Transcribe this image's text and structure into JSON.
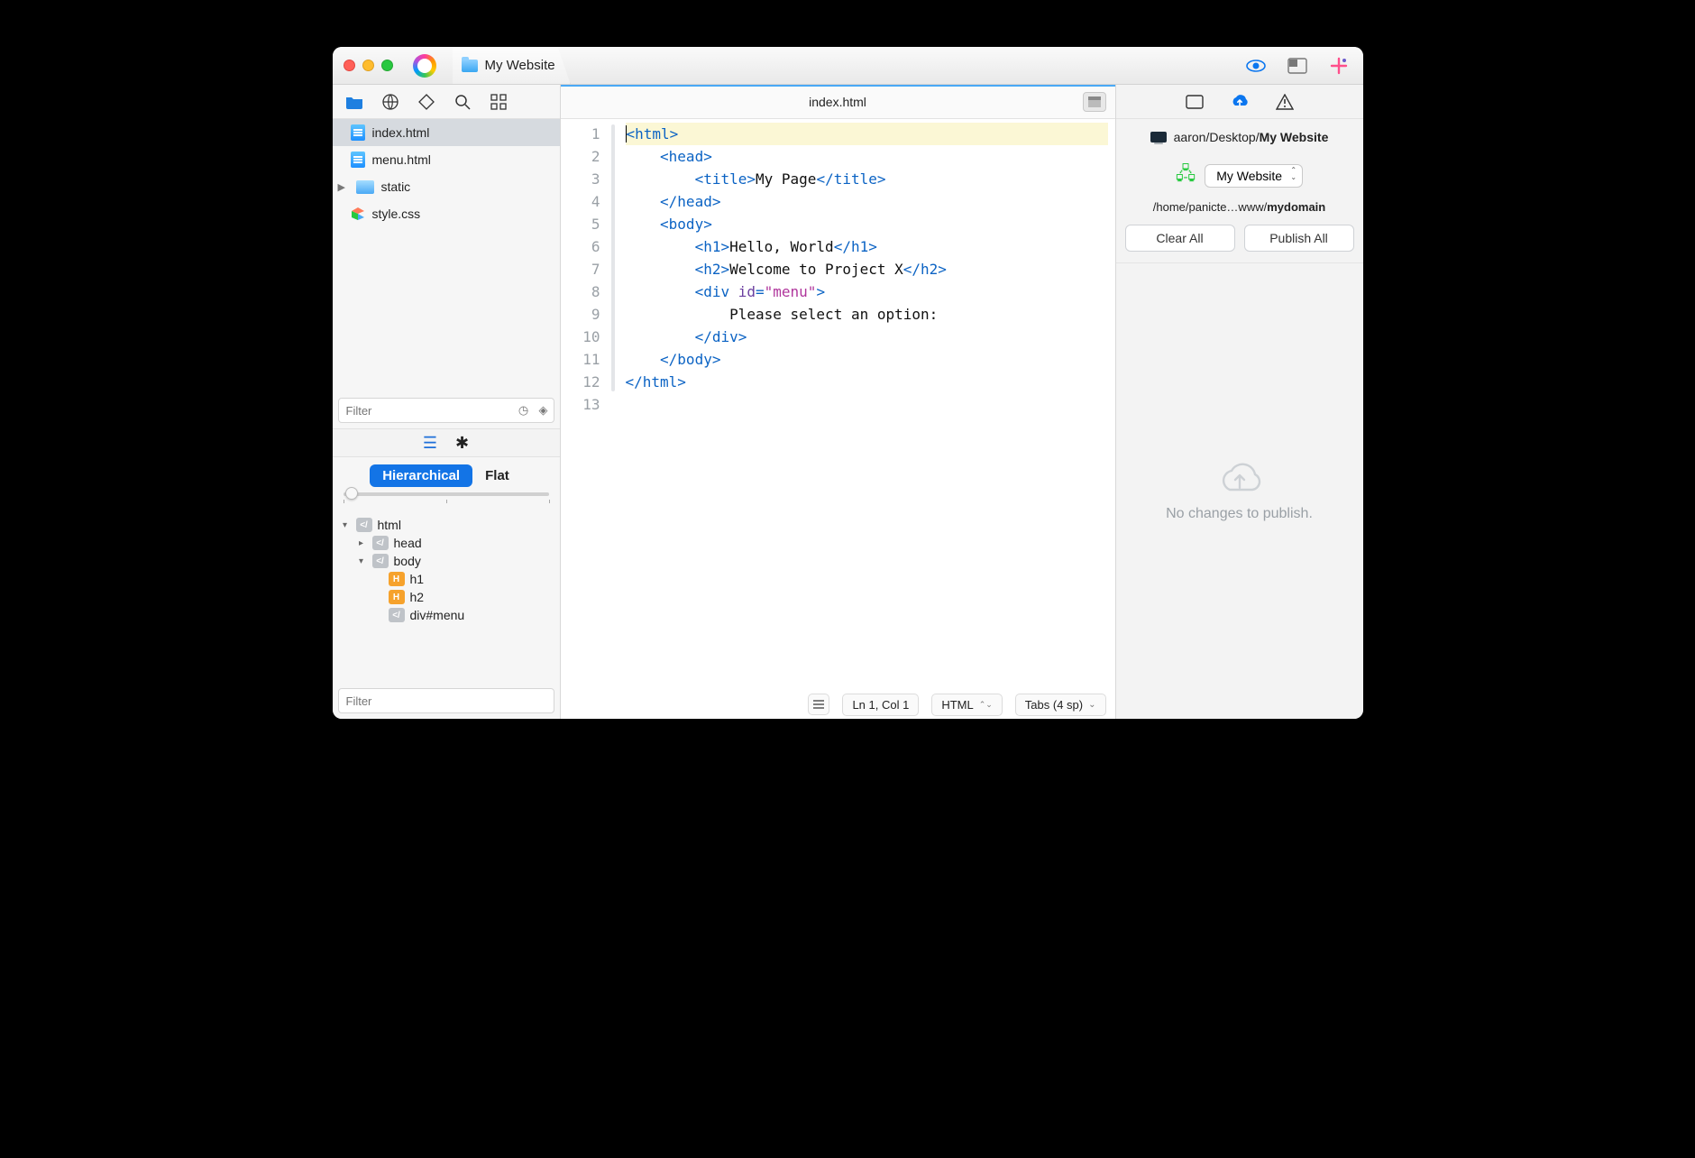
{
  "titlebar": {
    "tab": {
      "label": "My Website"
    }
  },
  "sidebar": {
    "filter_placeholder_top": "Filter",
    "filter_placeholder_bottom": "Filter",
    "files": [
      {
        "name": "index.html",
        "kind": "html",
        "selected": true
      },
      {
        "name": "menu.html",
        "kind": "html"
      },
      {
        "name": "static",
        "kind": "folder",
        "expandable": true
      },
      {
        "name": "style.css",
        "kind": "css"
      }
    ],
    "view": {
      "hierarchical": "Hierarchical",
      "flat": "Flat"
    },
    "outline": [
      {
        "label": "html",
        "indent": 0,
        "disc": "open",
        "tag": "gray"
      },
      {
        "label": "head",
        "indent": 1,
        "disc": "closed",
        "tag": "gray"
      },
      {
        "label": "body",
        "indent": 1,
        "disc": "open",
        "tag": "gray"
      },
      {
        "label": "h1",
        "indent": 2,
        "tag": "orange"
      },
      {
        "label": "h2",
        "indent": 2,
        "tag": "orange"
      },
      {
        "label": "div#menu",
        "indent": 2,
        "tag": "gray"
      }
    ]
  },
  "editor": {
    "filename": "index.html",
    "lines": 13,
    "content_tokens": [
      [
        {
          "t": "<",
          "c": "tag"
        },
        {
          "t": "html",
          "c": "tag"
        },
        {
          "t": ">",
          "c": "tag"
        }
      ],
      [
        {
          "t": "    <head>",
          "c": "tag"
        }
      ],
      [
        {
          "t": "        <title>",
          "c": "tag"
        },
        {
          "t": "My Page",
          "c": "txt"
        },
        {
          "t": "</title>",
          "c": "tag"
        }
      ],
      [
        {
          "t": "    </head>",
          "c": "tag"
        }
      ],
      [
        {
          "t": "    <body>",
          "c": "tag"
        }
      ],
      [
        {
          "t": "        <h1>",
          "c": "tag"
        },
        {
          "t": "Hello, World",
          "c": "txt"
        },
        {
          "t": "</h1>",
          "c": "tag"
        }
      ],
      [
        {
          "t": "        <h2>",
          "c": "tag"
        },
        {
          "t": "Welcome to Project X",
          "c": "txt"
        },
        {
          "t": "</h2>",
          "c": "tag"
        }
      ],
      [
        {
          "t": "        <div ",
          "c": "tag"
        },
        {
          "t": "id",
          "c": "attr"
        },
        {
          "t": "=",
          "c": "tag"
        },
        {
          "t": "\"menu\"",
          "c": "str"
        },
        {
          "t": ">",
          "c": "tag"
        }
      ],
      [
        {
          "t": "            Please select an option:",
          "c": "txt"
        }
      ],
      [
        {
          "t": "        </div>",
          "c": "tag"
        }
      ],
      [
        {
          "t": "    </body>",
          "c": "tag"
        }
      ],
      [
        {
          "t": "</",
          "c": "tag"
        },
        {
          "t": "html",
          "c": "tag"
        },
        {
          "t": ">",
          "c": "tag"
        }
      ],
      [
        {
          "t": "",
          "c": "txt"
        }
      ]
    ],
    "highlight_line": 1,
    "fold_bars": [
      {
        "start": 1,
        "end": 12
      },
      {
        "start": 2,
        "end": 4
      },
      {
        "start": 5,
        "end": 11
      },
      {
        "start": 8,
        "end": 10
      }
    ]
  },
  "statusbar": {
    "position": "Ln 1, Col 1",
    "language": "HTML",
    "indent": "Tabs (4 sp)"
  },
  "right": {
    "local_path_prefix": "aaron/Desktop/",
    "local_path_suffix": "My Website",
    "server_name": "My Website",
    "remote_path_prefix": "/home/panicte…www/",
    "remote_path_suffix": "mydomain",
    "clear_all": "Clear All",
    "publish_all": "Publish All",
    "empty_message": "No changes to publish."
  }
}
